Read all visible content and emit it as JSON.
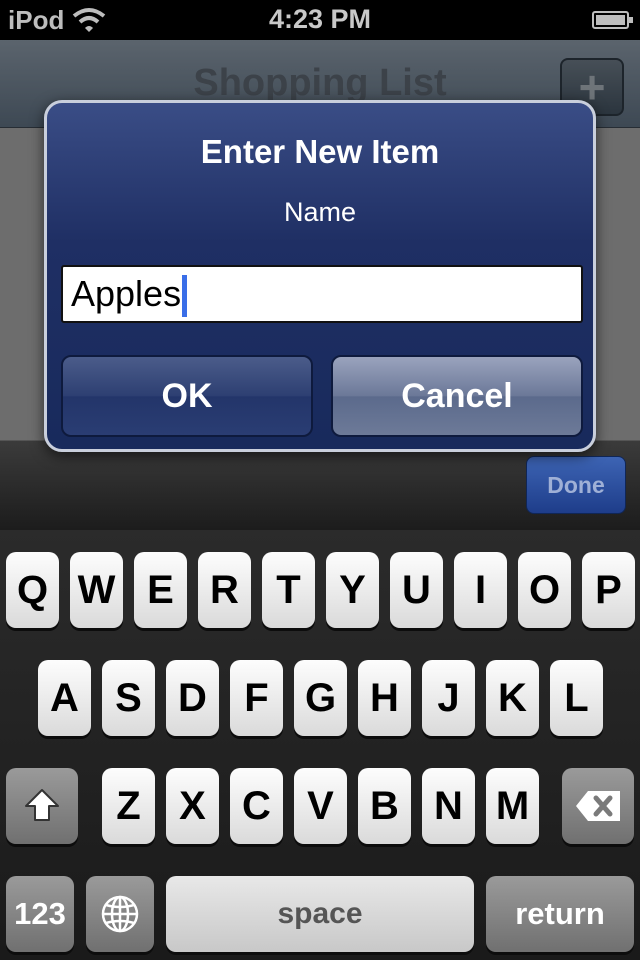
{
  "status_bar": {
    "carrier": "iPod",
    "time": "4:23 PM"
  },
  "nav": {
    "title": "Shopping List",
    "add_label": "+"
  },
  "accessory": {
    "done_label": "Done"
  },
  "alert": {
    "title": "Enter New Item",
    "subtitle": "Name",
    "input_value": "Apples",
    "ok_label": "OK",
    "cancel_label": "Cancel"
  },
  "keyboard": {
    "row1": [
      "Q",
      "W",
      "E",
      "R",
      "T",
      "Y",
      "U",
      "I",
      "O",
      "P"
    ],
    "row2": [
      "A",
      "S",
      "D",
      "F",
      "G",
      "H",
      "J",
      "K",
      "L"
    ],
    "row3": [
      "Z",
      "X",
      "C",
      "V",
      "B",
      "N",
      "M"
    ],
    "numbers_label": "123",
    "space_label": "space",
    "return_label": "return"
  },
  "colors": {
    "alert_bg": "#1f2f64",
    "done_bg": "#2c4fa0",
    "caret": "#3a6ee8"
  }
}
